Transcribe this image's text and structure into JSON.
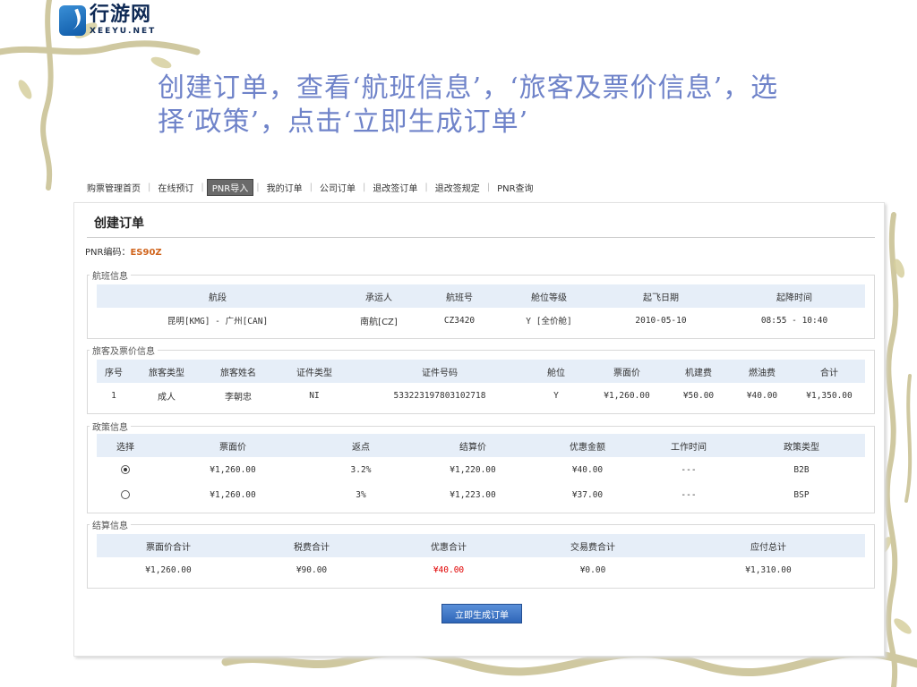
{
  "logo": {
    "name_cn": "行游网",
    "name_en": "XEEYU.NET"
  },
  "slide": {
    "title": "创建订单，查看‘航班信息’，‘旅客及票价信息’，选择‘政策’，点击‘立即生成订单’"
  },
  "topnav": {
    "items": [
      "购票管理首页",
      "在线预订",
      "PNR导入",
      "我的订单",
      "公司订单",
      "退改签订单",
      "退改签规定",
      "PNR查询"
    ],
    "active_index": 2
  },
  "order": {
    "title": "创建订单",
    "pnr_label": "PNR编码：",
    "pnr_code": "ES90Z"
  },
  "flight": {
    "legend": "航班信息",
    "headers": [
      "航段",
      "承运人",
      "航班号",
      "舱位等级",
      "起飞日期",
      "起降时间"
    ],
    "rows": [
      [
        "昆明[KMG] - 广州[CAN]",
        "南航[CZ]",
        "CZ3420",
        "Y [全价舱]",
        "2010-05-10",
        "08:55 - 10:40"
      ]
    ]
  },
  "passenger": {
    "legend": "旅客及票价信息",
    "headers": [
      "序号",
      "旅客类型",
      "旅客姓名",
      "证件类型",
      "证件号码",
      "舱位",
      "票面价",
      "机建费",
      "燃油费",
      "合计"
    ],
    "rows": [
      [
        "1",
        "成人",
        "李朝忠",
        "NI",
        "533223197803102718",
        "Y",
        "¥1,260.00",
        "¥50.00",
        "¥40.00",
        "¥1,350.00"
      ]
    ]
  },
  "policy": {
    "legend": "政策信息",
    "headers": [
      "选择",
      "票面价",
      "返点",
      "结算价",
      "优惠金额",
      "工作时间",
      "政策类型"
    ],
    "rows": [
      {
        "selected": true,
        "cells": [
          "¥1,260.00",
          "3.2%",
          "¥1,220.00",
          "¥40.00",
          "---",
          "B2B"
        ]
      },
      {
        "selected": false,
        "cells": [
          "¥1,260.00",
          "3%",
          "¥1,223.00",
          "¥37.00",
          "---",
          "BSP"
        ]
      }
    ]
  },
  "settlement": {
    "legend": "结算信息",
    "headers": [
      "票面价合计",
      "税费合计",
      "优惠合计",
      "交易费合计",
      "应付总计"
    ],
    "values": [
      "¥1,260.00",
      "¥90.00",
      "¥40.00",
      "¥0.00",
      "¥1,310.00"
    ],
    "highlight_color": "#e00000"
  },
  "actions": {
    "submit_label": "立即生成订单"
  }
}
